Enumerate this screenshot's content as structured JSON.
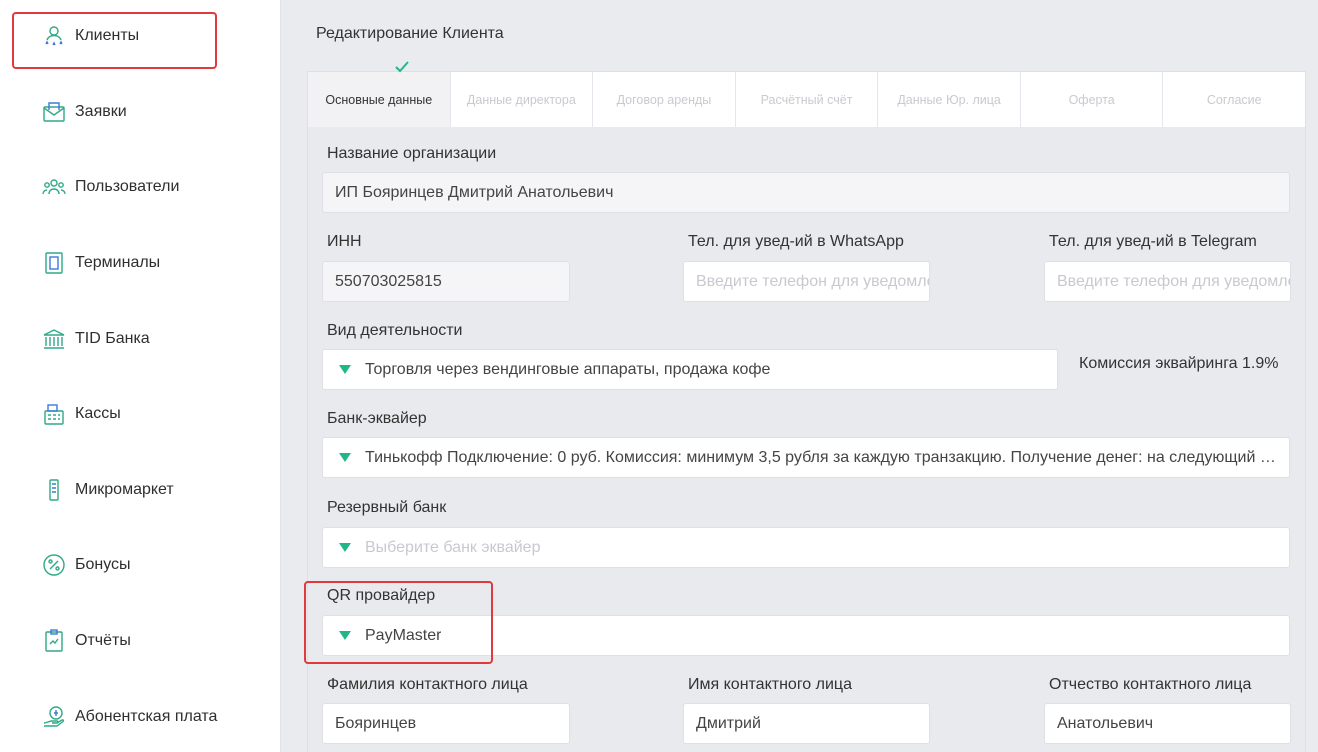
{
  "sidebar": {
    "items": [
      {
        "label": "Клиенты",
        "icon": "clients-icon"
      },
      {
        "label": "Заявки",
        "icon": "envelope-icon"
      },
      {
        "label": "Пользователи",
        "icon": "users-icon"
      },
      {
        "label": "Терминалы",
        "icon": "terminal-icon"
      },
      {
        "label": "TID Банка",
        "icon": "bank-icon"
      },
      {
        "label": "Кассы",
        "icon": "cash-register-icon"
      },
      {
        "label": "Микромаркет",
        "icon": "vending-machine-icon"
      },
      {
        "label": "Бонусы",
        "icon": "percent-icon"
      },
      {
        "label": "Отчёты",
        "icon": "report-icon"
      },
      {
        "label": "Абонентская плата",
        "icon": "subscription-icon"
      }
    ]
  },
  "page": {
    "title": "Редактирование Клиента"
  },
  "tabs": [
    {
      "label": "Основные данные",
      "active": true
    },
    {
      "label": "Данные директора"
    },
    {
      "label": "Договор аренды"
    },
    {
      "label": "Расчётный счёт"
    },
    {
      "label": "Данные Юр. лица"
    },
    {
      "label": "Оферта"
    },
    {
      "label": "Согласие"
    }
  ],
  "form": {
    "org_name": {
      "label": "Название организации",
      "value": "ИП Бояринцев Дмитрий Анатольевич"
    },
    "inn": {
      "label": "ИНН",
      "value": "550703025815"
    },
    "whatsapp": {
      "label": "Тел. для увед-ий в WhatsApp",
      "placeholder": "Введите телефон для уведомлений"
    },
    "telegram": {
      "label": "Тел. для увед-ий в Telegram",
      "placeholder": "Введите телефон для уведомлений"
    },
    "activity": {
      "label": "Вид деятельности",
      "value": "Торговля через вендинговые аппараты, продажа кофе"
    },
    "commission": "Комиссия эквайринга 1.9%",
    "acquirer": {
      "label": "Банк-эквайер",
      "value": "Тинькофф Подключение: 0 руб. Комиссия: минимум 3,5 рубля за каждую транзакцию. Получение денег: на следующий рабочий день"
    },
    "reserve_bank": {
      "label": "Резервный банк",
      "placeholder": "Выберите банк эквайер"
    },
    "qr_provider": {
      "label": "QR провайдер",
      "value": "PayMaster"
    },
    "last_name": {
      "label": "Фамилия контактного лица",
      "value": "Бояринцев"
    },
    "first_name": {
      "label": "Имя контактного лица",
      "value": "Дмитрий"
    },
    "middle_name": {
      "label": "Отчество контактного лица",
      "value": "Анатольевич"
    }
  },
  "colors": {
    "accent": "#1fb78a",
    "highlight": "#e0393e"
  }
}
